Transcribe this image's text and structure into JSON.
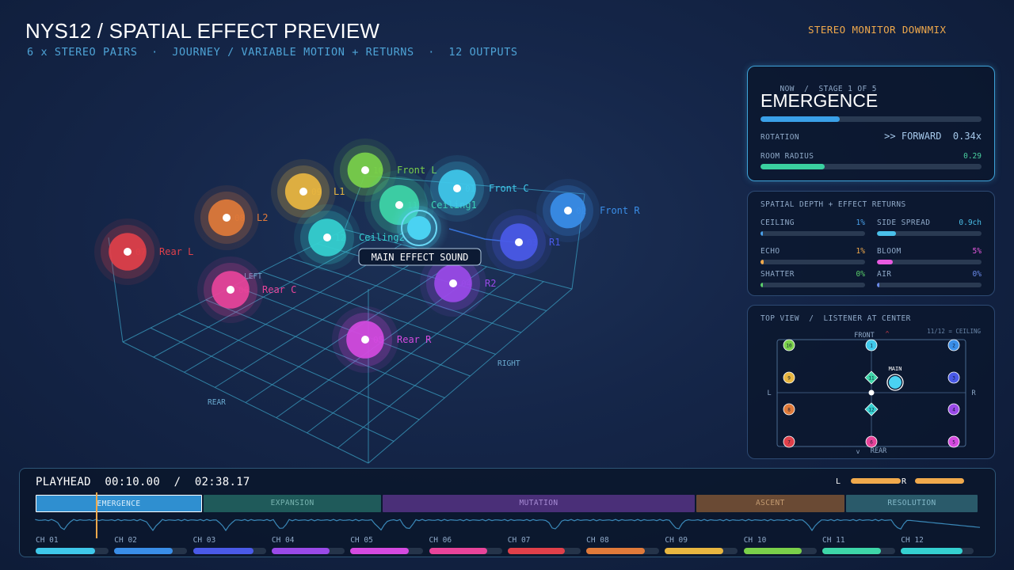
{
  "header": {
    "title": "NYS12 / SPATIAL EFFECT PREVIEW",
    "subtitle": "6 x STEREO PAIRS  ·  JOURNEY / VARIABLE MOTION + RETURNS  ·  12 OUTPUTS",
    "monitor_label": "STEREO MONITOR DOWNMIX"
  },
  "scene": {
    "main_label": "MAIN EFFECT SOUND",
    "axis_left": "LEFT",
    "axis_right": "RIGHT",
    "axis_rear": "REAR",
    "speakers": [
      {
        "num": "07",
        "name": "Rear L",
        "color": "#e0404a"
      },
      {
        "num": "08",
        "name": "L2",
        "color": "#e07a3a"
      },
      {
        "num": "09",
        "name": "L1",
        "color": "#e8b640"
      },
      {
        "num": "10",
        "name": "Front L",
        "color": "#7ad04a"
      },
      {
        "num": "11",
        "name": "Ceiling1",
        "color": "#3ed6a8"
      },
      {
        "num": "01",
        "name": "Front C",
        "color": "#3fc8ea"
      },
      {
        "num": "02",
        "name": "Front R",
        "color": "#3a8ee8"
      },
      {
        "num": "03",
        "name": "R1",
        "color": "#4a5ae8"
      },
      {
        "num": "12",
        "name": "Ceiling2",
        "color": "#35d0d0"
      },
      {
        "num": "06",
        "name": "Rear C",
        "color": "#e8449a"
      },
      {
        "num": "04",
        "name": "R2",
        "color": "#9a4ae8"
      },
      {
        "num": "05",
        "name": "Rear R",
        "color": "#d44ae0"
      }
    ]
  },
  "now_panel": {
    "now": "NOW",
    "stage": "STAGE 1 OF 5",
    "stage_name": "EMERGENCE",
    "stage_progress": 0.36,
    "rotation_label": "ROTATION",
    "rotation_dir": ">> FORWARD",
    "rotation_value": "0.34x",
    "room_radius_label": "ROOM RADIUS",
    "room_radius_value": "0.29"
  },
  "depth_panel": {
    "title": "SPATIAL DEPTH + EFFECT RETURNS",
    "params": [
      {
        "label": "CEILING",
        "value": "1%",
        "level": 0.02,
        "color": "#4aa0ea"
      },
      {
        "label": "SIDE SPREAD",
        "value": "0.9ch",
        "level": 0.18,
        "color": "#4ac0ea"
      },
      {
        "label": "ECHO",
        "value": "1%",
        "level": 0.03,
        "color": "#f0a94c"
      },
      {
        "label": "BLOOM",
        "value": "5%",
        "level": 0.15,
        "color": "#e85ae0"
      },
      {
        "label": "SHATTER",
        "value": "0%",
        "level": 0.02,
        "color": "#5ad06a"
      },
      {
        "label": "AIR",
        "value": "0%",
        "level": 0.02,
        "color": "#6a8aea"
      }
    ]
  },
  "top_view": {
    "title": "TOP VIEW  /  LISTENER AT CENTER",
    "legend": "11/12 = CEILING",
    "front": "FRONT",
    "rear": "REAR",
    "left": "L",
    "right": "R",
    "main": "MAIN",
    "front_marker": "^",
    "rear_marker": "v"
  },
  "timeline": {
    "playhead_label": "PLAYHEAD",
    "current": "00:10.00",
    "separator": "/",
    "total": "02:38.17",
    "meter_l": "L",
    "meter_r": "R",
    "meter_l_level": 0.9,
    "meter_r_level": 0.95,
    "playhead_fraction": 0.064,
    "segments": [
      {
        "label": "EMERGENCE",
        "fraction": 0.178,
        "bg": "#2f8fd0",
        "fg": "#d8eefc",
        "active": true
      },
      {
        "label": "EXPANSION",
        "fraction": 0.19,
        "bg": "#1f5a5a",
        "fg": "#78b4b0",
        "active": false
      },
      {
        "label": "MUTATION",
        "fraction": 0.332,
        "bg": "#4a2f78",
        "fg": "#a68ad4",
        "active": false
      },
      {
        "label": "ASCENT",
        "fraction": 0.159,
        "bg": "#6a4a34",
        "fg": "#c29a70",
        "active": false
      },
      {
        "label": "RESOLUTION",
        "fraction": 0.141,
        "bg": "#2a5a6a",
        "fg": "#82b8c8",
        "active": false
      }
    ],
    "channels": [
      {
        "label": "CH 01",
        "level": 0.82,
        "color": "#3fc8ea"
      },
      {
        "label": "CH 02",
        "level": 0.8,
        "color": "#3a8ee8"
      },
      {
        "label": "CH 03",
        "level": 0.83,
        "color": "#4a5ae8"
      },
      {
        "label": "CH 04",
        "level": 0.8,
        "color": "#9a4ae8"
      },
      {
        "label": "CH 05",
        "level": 0.8,
        "color": "#d44ae0"
      },
      {
        "label": "CH 06",
        "level": 0.8,
        "color": "#e8449a"
      },
      {
        "label": "CH 07",
        "level": 0.78,
        "color": "#e0404a"
      },
      {
        "label": "CH 08",
        "level": 0.8,
        "color": "#e07a3a"
      },
      {
        "label": "CH 09",
        "level": 0.8,
        "color": "#e8b640"
      },
      {
        "label": "CH 10",
        "level": 0.8,
        "color": "#7ad04a"
      },
      {
        "label": "CH 11",
        "level": 0.8,
        "color": "#3ed6a8"
      },
      {
        "label": "CH 12",
        "level": 0.84,
        "color": "#35d0d0"
      }
    ]
  }
}
